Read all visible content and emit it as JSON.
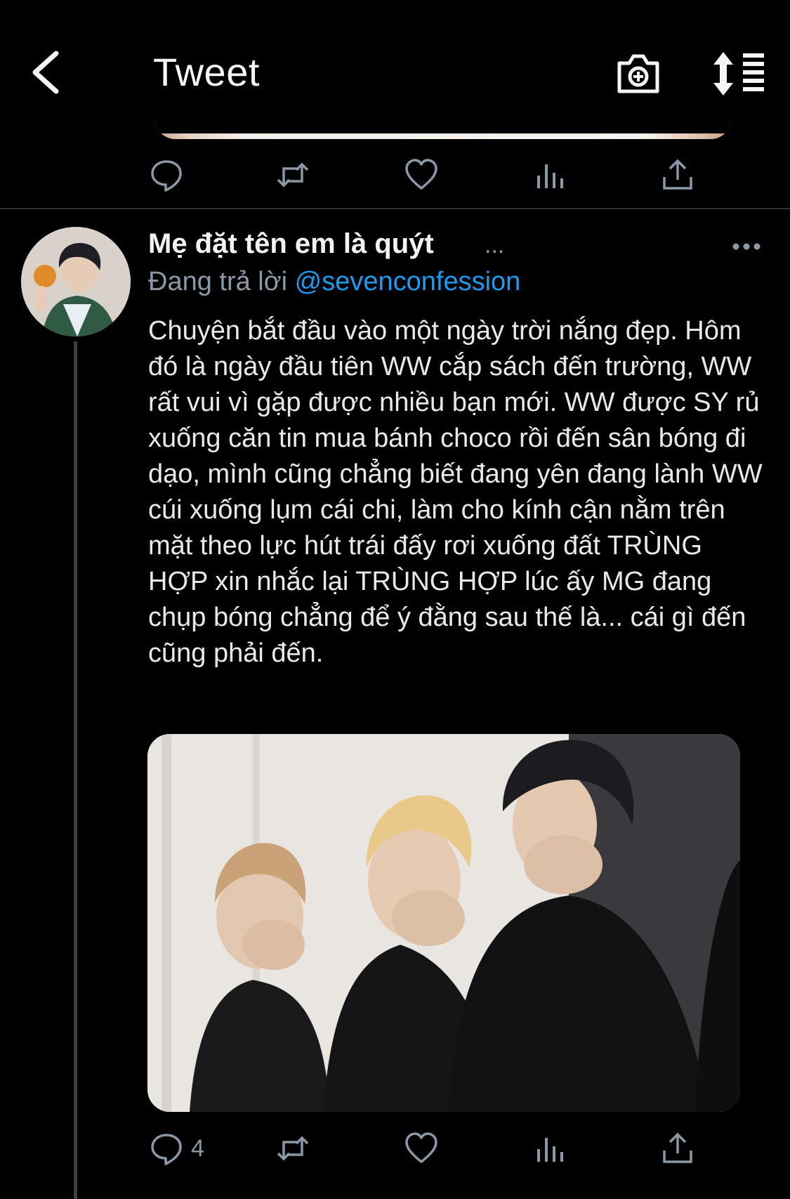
{
  "header": {
    "title": "Tweet",
    "back_icon": "chevron-left-icon",
    "camera_icon": "camera-add-icon",
    "sort_icon": "sort-icon"
  },
  "previous_tweet": {
    "actions": [
      "reply-icon",
      "retweet-icon",
      "like-icon",
      "analytics-icon",
      "share-icon"
    ]
  },
  "reply": {
    "author_name": "Mẹ đặt tên em là quýt",
    "name_truncation": "...",
    "replying_label": "Đang trả lời",
    "replying_handle": "@sevenconfession",
    "text": "Chuyện bắt đầu vào một ngày trời nắng đẹp. Hôm đó là ngày đầu tiên WW cắp sách đến trường, WW rất vui vì gặp được nhiều bạn mới. WW được SY rủ xuống căn tin mua bánh choco rồi đến sân bóng đi dạo, mình cũng chẳng biết đang yên đang lành WW cúi xuống lụm cái chi, làm cho kính cận nằm trên mặt theo lực hút trái đấy rơi xuống đất TRÙNG HỢP xin nhắc lại TRÙNG HỢP lúc ấy MG đang chụp bóng chẳng để ý đằng sau thế là... cái gì đến cũng phải đến.",
    "reply_count": "4",
    "actions": [
      "reply-icon",
      "retweet-icon",
      "like-icon",
      "analytics-icon",
      "share-icon"
    ]
  },
  "colors": {
    "background": "#000000",
    "text": "#e7e9ea",
    "secondary": "#8b98a5",
    "link": "#1d9bf0"
  }
}
